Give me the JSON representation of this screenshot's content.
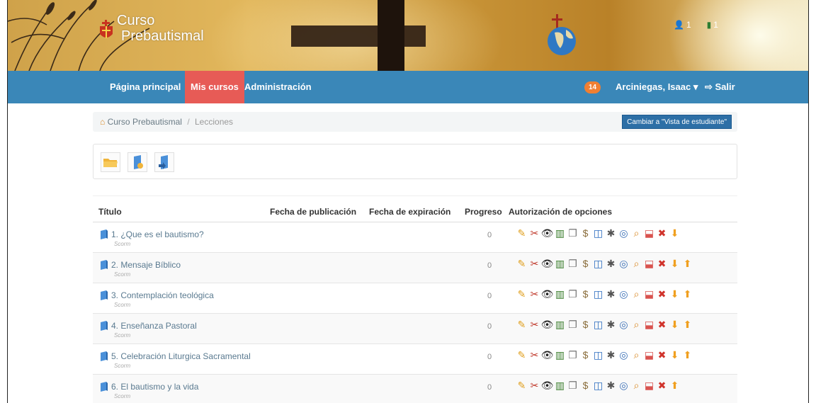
{
  "header": {
    "logo_line1": "Curso",
    "logo_line2": "Prebautismal",
    "stat1": "1",
    "stat2": "1"
  },
  "nav": {
    "home": "Página principal",
    "courses": "Mis cursos",
    "admin": "Administración",
    "badge": "14",
    "user": "Arciniegas, Isaac ▾",
    "logout": "Salir"
  },
  "breadcrumb": {
    "root": "Curso Prebautismal",
    "separator": "/",
    "current": "Lecciones",
    "switch_button": "Cambiar a \"Vista de estudiante\""
  },
  "table": {
    "headers": {
      "title": "Título",
      "published": "Fecha de publicación",
      "expires": "Fecha de expiración",
      "progress": "Progreso",
      "options": "Autorización de opciones"
    },
    "rows": [
      {
        "title": "1. ¿Que es el bautismo?",
        "type": "Scorm",
        "progress": "0"
      },
      {
        "title": "2. Mensaje Bíblico",
        "type": "Scorm",
        "progress": "0"
      },
      {
        "title": "3. Contemplación teológica",
        "type": "Scorm",
        "progress": "0"
      },
      {
        "title": "4. Enseñanza Pastoral",
        "type": "Scorm",
        "progress": "0"
      },
      {
        "title": "5. Celebración Liturgica Sacramental",
        "type": "Scorm",
        "progress": "0"
      },
      {
        "title": "6. El bautismo y la vida",
        "type": "Scorm",
        "progress": "0"
      }
    ]
  },
  "colors": {
    "nav": "#3a87b8",
    "nav_active": "#e75b56",
    "badge": "#f07f32",
    "switch_button": "#2d6fa6"
  },
  "icons": [
    "home-icon",
    "folder-icon",
    "upload-icon",
    "import-icon",
    "edit-icon",
    "tools-icon",
    "visibility-icon",
    "stats-icon",
    "copy-icon",
    "money-icon",
    "layout-icon",
    "bug-icon",
    "target-icon",
    "search-icon",
    "pdf-icon",
    "delete-icon",
    "move-down-icon",
    "move-up-icon"
  ]
}
